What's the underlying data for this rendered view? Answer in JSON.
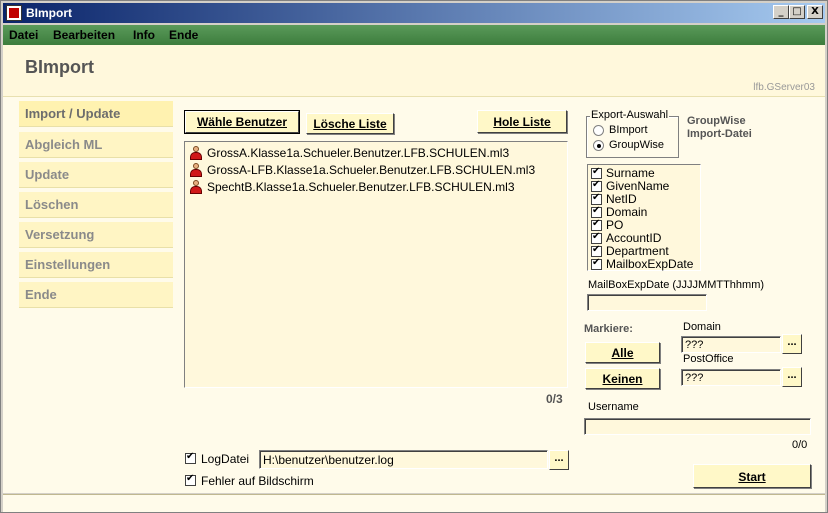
{
  "window": {
    "title": "BImport",
    "controls": {
      "minimize": "_",
      "maximize": "□",
      "close": "X"
    }
  },
  "menu": [
    "Datei",
    "Bearbeiten",
    "Info",
    "Ende"
  ],
  "header": {
    "title": "BImport",
    "server": "lfb.GServer03"
  },
  "sidebar": [
    {
      "label": "Import / Update",
      "active": true
    },
    {
      "label": "Abgleich ML"
    },
    {
      "label": "Update"
    },
    {
      "label": "Löschen"
    },
    {
      "label": "Versetzung"
    },
    {
      "label": "Einstellungen"
    },
    {
      "label": "Ende"
    }
  ],
  "toolbar": {
    "select_users": "Wähle Benutzer",
    "clear_list": "Lösche Liste",
    "fetch_list": "Hole Liste"
  },
  "user_list": [
    "GrossA.Klasse1a.Schueler.Benutzer.LFB.SCHULEN.ml3",
    "GrossA-LFB.Klasse1a.Schueler.Benutzer.LFB.SCHULEN.ml3",
    "SpechtB.Klasse1a.Schueler.Benutzer.LFB.SCHULEN.ml3"
  ],
  "list_count": "0/3",
  "export": {
    "legend": "Export-Auswahl",
    "options": [
      {
        "label": "BImport",
        "selected": false
      },
      {
        "label": "GroupWise",
        "selected": true
      }
    ],
    "gw_line1": "GroupWise",
    "gw_line2": "Import-Datei"
  },
  "fields": [
    {
      "label": "Surname",
      "checked": true
    },
    {
      "label": "GivenName",
      "checked": true
    },
    {
      "label": "NetID",
      "checked": true
    },
    {
      "label": "Domain",
      "checked": true
    },
    {
      "label": "PO",
      "checked": true
    },
    {
      "label": "AccountID",
      "checked": true
    },
    {
      "label": "Department",
      "checked": true
    },
    {
      "label": "MailboxExpDate",
      "checked": true
    }
  ],
  "mailbox_exp": {
    "label": "MailBoxExpDate (JJJJMMTThhmm)",
    "value": ""
  },
  "mark": {
    "label": "Markiere:",
    "all": "Alle",
    "none": "Keinen"
  },
  "domain": {
    "label": "Domain",
    "value": "???"
  },
  "postoffice": {
    "label": "PostOffice",
    "value": "???"
  },
  "username": {
    "label": "Username",
    "value": "",
    "count": "0/0"
  },
  "logfile": {
    "label": "LogDatei",
    "checked": true,
    "value": "H:\\benutzer\\benutzer.log"
  },
  "screen_errors": {
    "label": "Fehler auf Bildschirm",
    "checked": true
  },
  "browse": "...",
  "start": "Start"
}
